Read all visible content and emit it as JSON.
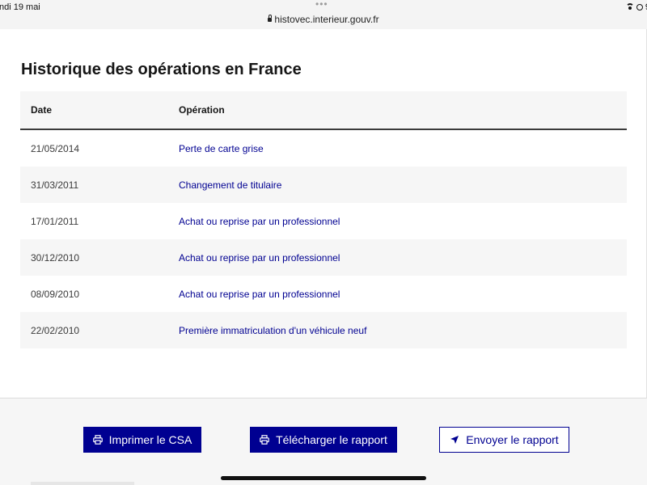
{
  "status_bar": {
    "time": "ndi 19 mai",
    "url": "histovec.interieur.gouv.fr",
    "battery_partial": "9"
  },
  "section": {
    "title": "Historique des opérations en France"
  },
  "table": {
    "headers": {
      "date": "Date",
      "operation": "Opération"
    },
    "rows": [
      {
        "date": "21/05/2014",
        "operation": "Perte de carte grise"
      },
      {
        "date": "31/03/2011",
        "operation": "Changement de titulaire"
      },
      {
        "date": "17/01/2011",
        "operation": "Achat ou reprise par un professionnel"
      },
      {
        "date": "30/12/2010",
        "operation": "Achat ou reprise par un professionnel"
      },
      {
        "date": "08/09/2010",
        "operation": "Achat ou reprise par un professionnel"
      },
      {
        "date": "22/02/2010",
        "operation": "Première immatriculation d'un véhicule neuf"
      }
    ]
  },
  "actions": {
    "print_label": "Imprimer le CSA",
    "download_label": "Télécharger le rapport",
    "send_label": "Envoyer le rapport"
  },
  "icons": {
    "lock": "lock-icon",
    "wifi": "wifi-icon",
    "print": "printer-icon",
    "send": "send-arrow-icon"
  },
  "colors": {
    "primary": "#000091",
    "text": "#161616",
    "row_alt": "#f6f6f6",
    "page_bg": "#f6f6f6"
  }
}
